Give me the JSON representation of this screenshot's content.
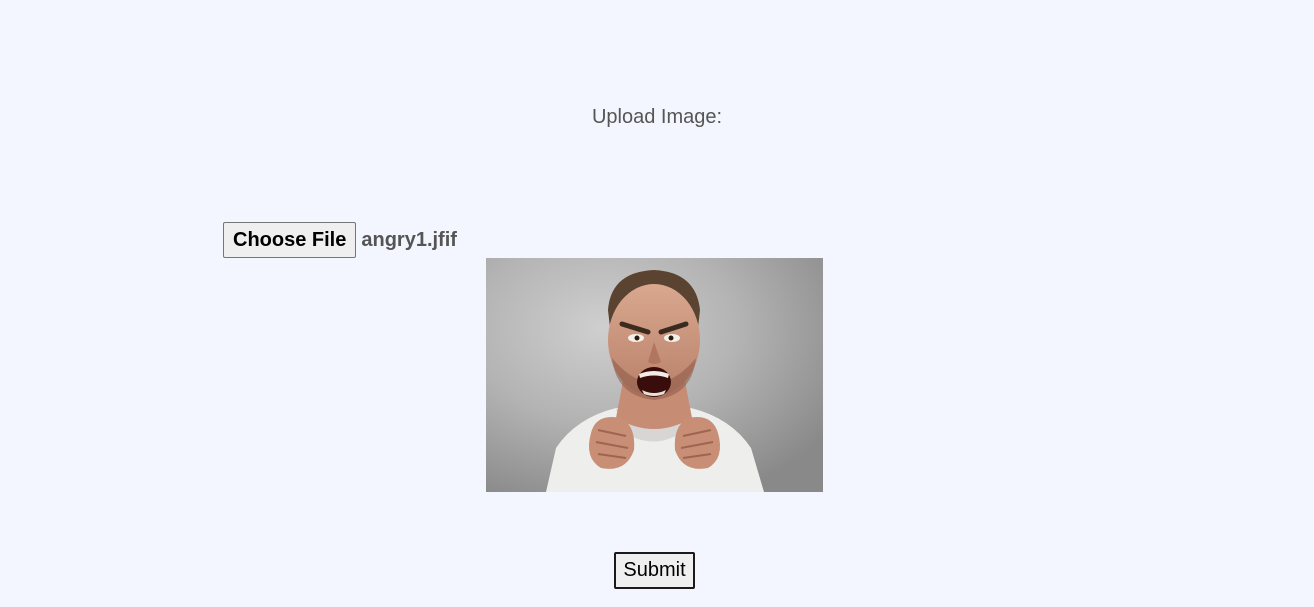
{
  "form": {
    "upload_label": "Upload Image:",
    "file_input": {
      "button_label": "Choose File",
      "selected_file": "angry1.jfif"
    },
    "preview": {
      "alt": "angry1.jfif"
    },
    "submit_label": "Submit"
  },
  "colors": {
    "background": "#f3f6fe",
    "label_text": "#555555",
    "button_bg": "#efefef"
  }
}
